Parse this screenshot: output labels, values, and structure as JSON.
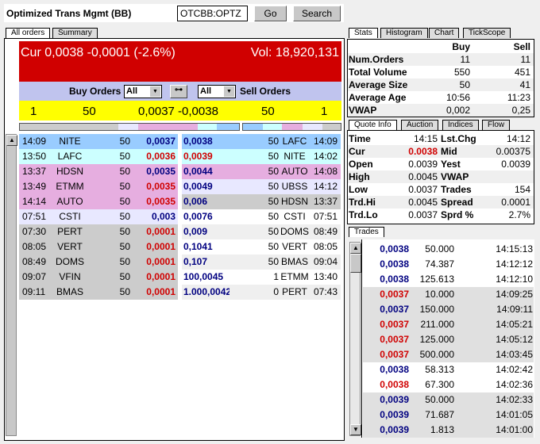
{
  "header": {
    "title": "Optimized Trans Mgmt (BB)",
    "symbol": "OTCBB:OPTZ",
    "go_label": "Go",
    "search_label": "Search"
  },
  "left_tabs": [
    "All orders",
    "Summary"
  ],
  "summary": {
    "cur": "Cur 0,0038 -0,0001 (-2.6%)",
    "vol": "Vol: 18,920,131"
  },
  "filter": {
    "buy_label": "Buy Orders",
    "buy_value": "All",
    "sell_label": "Sell Orders",
    "sell_value": "All"
  },
  "best": {
    "buy_count": "1",
    "buy_size": "50",
    "spread": "0,0037 -0,0038",
    "sell_size": "50",
    "sell_count": "1"
  },
  "colors": {
    "level1": "#99ccff",
    "level2": "#ccffff",
    "level3": "#e6aee0",
    "level4": "#e8e8ff",
    "level5": "#cccccc",
    "header_red": "#d00000",
    "buy_price": "#000080",
    "sell_price": "#d00000"
  },
  "buy_orders": [
    {
      "time": "14:09",
      "mm": "NITE",
      "size": "50",
      "price": "0,0037",
      "c": "blue",
      "bg": "#99ccff"
    },
    {
      "time": "13:50",
      "mm": "LAFC",
      "size": "50",
      "price": "0,0036",
      "c": "red",
      "bg": "#ccffff"
    },
    {
      "time": "13:37",
      "mm": "HDSN",
      "size": "50",
      "price": "0,0035",
      "c": "blue",
      "bg": "#e6aee0"
    },
    {
      "time": "13:49",
      "mm": "ETMM",
      "size": "50",
      "price": "0,0035",
      "c": "red",
      "bg": "#e6aee0"
    },
    {
      "time": "14:14",
      "mm": "AUTO",
      "size": "50",
      "price": "0,0035",
      "c": "red",
      "bg": "#e6aee0"
    },
    {
      "time": "07:51",
      "mm": "CSTI",
      "size": "50",
      "price": "0,003",
      "c": "blue",
      "bg": "#e8e8ff"
    },
    {
      "time": "07:30",
      "mm": "PERT",
      "size": "50",
      "price": "0,0001",
      "c": "red",
      "bg": "#cccccc"
    },
    {
      "time": "08:05",
      "mm": "VERT",
      "size": "50",
      "price": "0,0001",
      "c": "red",
      "bg": "#cccccc"
    },
    {
      "time": "08:49",
      "mm": "DOMS",
      "size": "50",
      "price": "0,0001",
      "c": "red",
      "bg": "#cccccc"
    },
    {
      "time": "09:07",
      "mm": "VFIN",
      "size": "50",
      "price": "0,0001",
      "c": "red",
      "bg": "#cccccc"
    },
    {
      "time": "09:11",
      "mm": "BMAS",
      "size": "50",
      "price": "0,0001",
      "c": "red",
      "bg": "#cccccc"
    }
  ],
  "sell_orders": [
    {
      "price": "0,0038",
      "size": "50",
      "mm": "LAFC",
      "time": "14:09",
      "c": "blue",
      "bg": "#99ccff"
    },
    {
      "price": "0,0039",
      "size": "50",
      "mm": "NITE",
      "time": "14:02",
      "c": "red",
      "bg": "#ccffff"
    },
    {
      "price": "0,0044",
      "size": "50",
      "mm": "AUTO",
      "time": "14:08",
      "c": "blue",
      "bg": "#e6aee0"
    },
    {
      "price": "0,0049",
      "size": "50",
      "mm": "UBSS",
      "time": "14:12",
      "c": "blue",
      "bg": "#e8e8ff"
    },
    {
      "price": "0,006",
      "size": "50",
      "mm": "HDSN",
      "time": "13:37",
      "c": "blue",
      "bg": "#cccccc"
    },
    {
      "price": "0,0076",
      "size": "50",
      "mm": "CSTI",
      "time": "07:51",
      "c": "blue",
      "bg": "#ffffff"
    },
    {
      "price": "0,009",
      "size": "50",
      "mm": "DOMS",
      "time": "08:49",
      "c": "blue",
      "bg": "#efefef"
    },
    {
      "price": "0,1041",
      "size": "50",
      "mm": "VERT",
      "time": "08:05",
      "c": "blue",
      "bg": "#ffffff"
    },
    {
      "price": "0,107",
      "size": "50",
      "mm": "BMAS",
      "time": "09:04",
      "c": "blue",
      "bg": "#efefef"
    },
    {
      "price": "100,0045",
      "size": "1",
      "mm": "ETMM",
      "time": "13:40",
      "c": "blue",
      "bg": "#ffffff"
    },
    {
      "price": "1.000,0042",
      "size": "0",
      "mm": "PERT",
      "time": "07:43",
      "c": "blue",
      "bg": "#efefef"
    }
  ],
  "stats_tabs": [
    "Stats",
    "Histogram",
    "Chart",
    "TickScope"
  ],
  "stats": {
    "headers": [
      "",
      "Buy",
      "Sell"
    ],
    "rows": [
      [
        "Num.Orders",
        "11",
        "11"
      ],
      [
        "Total Volume",
        "550",
        "451"
      ],
      [
        "Average Size",
        "50",
        "41"
      ],
      [
        "Average Age",
        "10:56",
        "11:23"
      ],
      [
        "VWAP",
        "0,002",
        "0,25"
      ]
    ]
  },
  "quote_tabs": [
    "Quote Info",
    "Auction",
    "Indices",
    "Flow"
  ],
  "quote": [
    [
      "Time",
      "14:15",
      "Lst.Chg",
      "14:12"
    ],
    [
      "Cur",
      "0.0038",
      "Mid",
      "0.00375"
    ],
    [
      "Open",
      "0.0039",
      "Yest",
      "0.0039"
    ],
    [
      "High",
      "0.0045",
      "VWAP",
      ""
    ],
    [
      "Low",
      "0.0037",
      "Trades",
      "154"
    ],
    [
      "Trd.Hi",
      "0.0045",
      "Spread",
      "0.0001"
    ],
    [
      "Trd.Lo",
      "0.0037",
      "Sprd %",
      "2.7%"
    ]
  ],
  "trades_tab": "Trades",
  "trades": [
    {
      "price": "0,0038",
      "vol": "50.000",
      "time": "14:15:13",
      "c": "blue",
      "bg": "#ffffff"
    },
    {
      "price": "0,0038",
      "vol": "74.387",
      "time": "14:12:12",
      "c": "blue",
      "bg": "#ffffff"
    },
    {
      "price": "0,0038",
      "vol": "125.613",
      "time": "14:12:10",
      "c": "blue",
      "bg": "#ffffff"
    },
    {
      "price": "0,0037",
      "vol": "10.000",
      "time": "14:09:25",
      "c": "red",
      "bg": "#e0e0e0"
    },
    {
      "price": "0,0037",
      "vol": "150.000",
      "time": "14:09:11",
      "c": "blue",
      "bg": "#e0e0e0"
    },
    {
      "price": "0,0037",
      "vol": "211.000",
      "time": "14:05:21",
      "c": "red",
      "bg": "#e0e0e0"
    },
    {
      "price": "0,0037",
      "vol": "125.000",
      "time": "14:05:12",
      "c": "red",
      "bg": "#e0e0e0"
    },
    {
      "price": "0,0037",
      "vol": "500.000",
      "time": "14:03:45",
      "c": "red",
      "bg": "#e0e0e0"
    },
    {
      "price": "0,0038",
      "vol": "58.313",
      "time": "14:02:42",
      "c": "blue",
      "bg": "#ffffff"
    },
    {
      "price": "0,0038",
      "vol": "67.300",
      "time": "14:02:36",
      "c": "red",
      "bg": "#ffffff"
    },
    {
      "price": "0,0039",
      "vol": "50.000",
      "time": "14:02:33",
      "c": "blue",
      "bg": "#e0e0e0"
    },
    {
      "price": "0,0039",
      "vol": "71.687",
      "time": "14:01:05",
      "c": "blue",
      "bg": "#e0e0e0"
    },
    {
      "price": "0,0039",
      "vol": "1.813",
      "time": "14:01:00",
      "c": "blue",
      "bg": "#e0e0e0"
    }
  ]
}
